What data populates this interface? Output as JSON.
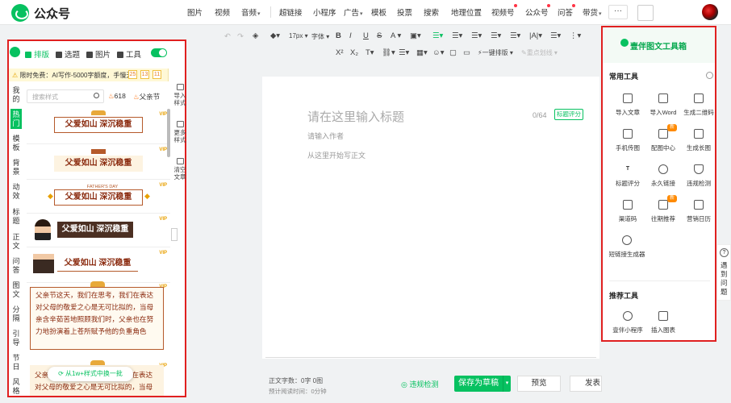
{
  "app": {
    "name": "公众号"
  },
  "topnav": {
    "items": [
      "图片",
      "视频",
      "音频",
      "超链接",
      "小程序",
      "广告",
      "模板",
      "投票",
      "搜索",
      "地理位置",
      "视频号",
      "公众号",
      "问答",
      "带货",
      "···"
    ]
  },
  "toolbar": {
    "font_size": "17px",
    "font_label": "字体",
    "one_click_layout": "一键排版",
    "divider_label": "重点划线"
  },
  "left_panel": {
    "tabs": [
      "排版",
      "选题",
      "图片",
      "工具"
    ],
    "promo": "限时免费：AI写作-5000字额度，手慢无！",
    "promo_counts": [
      "25",
      "13",
      "11"
    ],
    "categories": [
      "我的",
      "热门",
      "模板",
      "背景",
      "动效",
      "标题",
      "正文",
      "问答",
      "图文",
      "分隔",
      "引导",
      "节日",
      "风格"
    ],
    "search_placeholder": "搜索样式",
    "hot_count": "618",
    "hot_tag": "父亲节",
    "vip": "VIP",
    "templates": {
      "t1": "父爱如山 深沉稳重",
      "t2": "父爱如山 深沉稳重",
      "t3_small": "FATHER'S DAY",
      "t3": "父爱如山 深沉稳重",
      "t4": "父爱如山 深沉稳重",
      "t5": "父爱如山 深沉稳重"
    },
    "paragraph": "父亲节这天，我们在思考，我们在表达对父母的敬爱之心是无可比拟的，当母亲含辛茹苦地照顾我们时，父亲也在努力地扮演着上苍所赋予他的负重角色",
    "paragraph2": "父亲节这天，我们在思考，我们在表达对父母的敬爱之心是无可比拟的，当母",
    "switch_btn": "从1w+样式中换一批",
    "side_tools": [
      "导入样式",
      "更多样式",
      "清空文章"
    ]
  },
  "editor": {
    "title_placeholder": "请在这里输入标题",
    "title_count": "0/64",
    "title_score": "标题评分",
    "author_placeholder": "请输入作者",
    "body_placeholder": "从这里开始写正文"
  },
  "bottom": {
    "word_count": "正文字数：0字 0图",
    "read_time": "预计阅读时间：0分钟",
    "violation": "违规检测",
    "save_draft": "保存为草稿",
    "preview": "预览",
    "publish": "发表"
  },
  "right_panel": {
    "header": "壹伴图文工具箱",
    "common_title": "常用工具",
    "tools": [
      "导入文章",
      "导入Word",
      "生成二维码",
      "手机传图",
      "配图中心",
      "生成长图",
      "标题评分",
      "永久链接",
      "违规检测",
      "渠道码",
      "往期推荐",
      "营销日历",
      "短链接生成器"
    ],
    "new_badge": "新",
    "recommend_title": "推荐工具",
    "recommend": [
      "壹伴小程序",
      "插入图表"
    ]
  },
  "side_help": "遇到问题",
  "colors": {
    "accent": "#07c160",
    "highlight": "#e02020",
    "template_brown": "#8a2a0e"
  }
}
